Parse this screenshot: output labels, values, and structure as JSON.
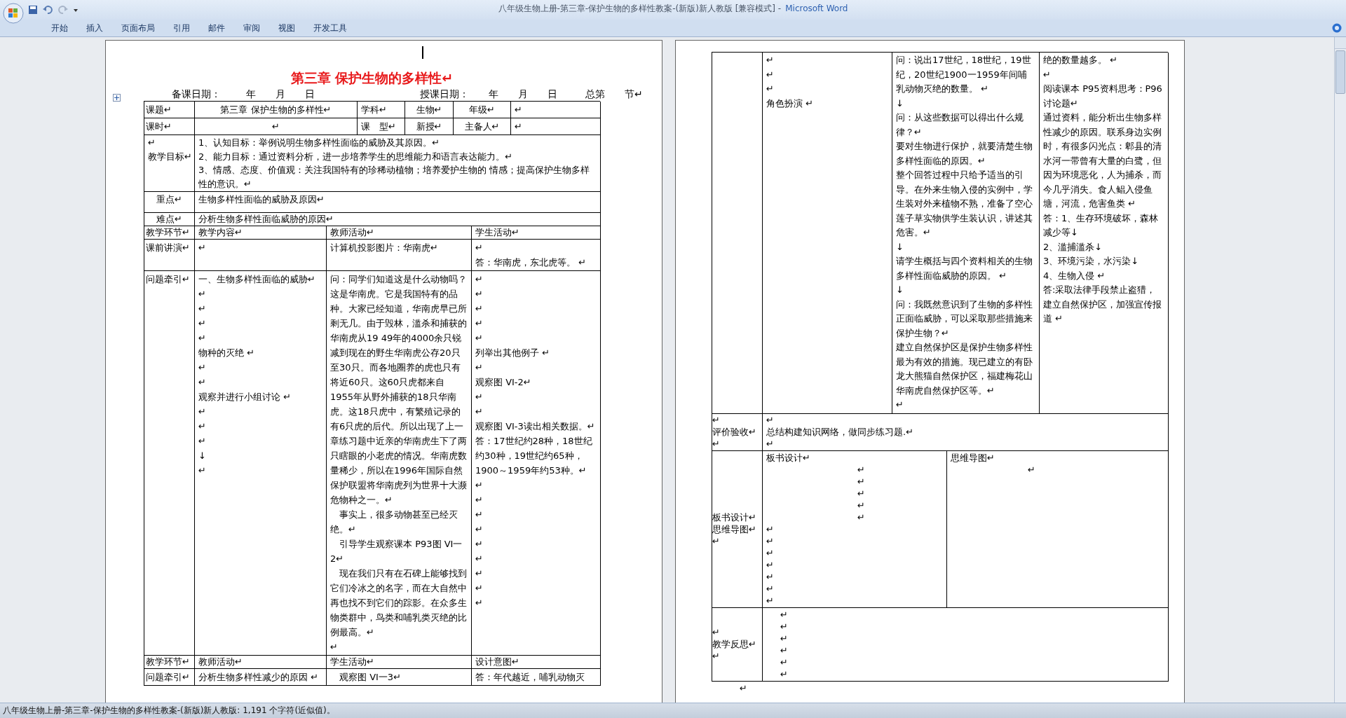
{
  "window": {
    "document_title": "八年级生物上册-第三章-保护生物的多样性教案-(新版)新人教版 [兼容模式] -",
    "app_name": "Microsoft Word"
  },
  "ribbon_tabs": [
    {
      "label": "开始",
      "selected": false
    },
    {
      "label": "插入",
      "selected": false
    },
    {
      "label": "页面布局",
      "selected": false
    },
    {
      "label": "引用",
      "selected": false
    },
    {
      "label": "邮件",
      "selected": false
    },
    {
      "label": "审阅",
      "selected": false
    },
    {
      "label": "视图",
      "selected": false
    },
    {
      "label": "开发工具",
      "selected": false
    }
  ],
  "left_page": {
    "heading": "第三章  保护生物的多样性↵",
    "prep_date": [
      "备课日期：",
      "年",
      "月",
      "日"
    ],
    "class_date": [
      "授课日期：",
      "年",
      "月",
      "日"
    ],
    "total": [
      "总第",
      "节↵"
    ],
    "info_rows": [
      [
        "课题↵",
        "第三章 保护生物的多样性↵",
        "学科↵",
        "生物↵",
        "年级↵",
        "↵"
      ],
      [
        "课时↵",
        "↵",
        "课　型↵",
        "新授↵",
        "主备人↵",
        "↵"
      ]
    ],
    "objectives": {
      "label": [
        "↵",
        "教学目标↵"
      ],
      "items": [
        "1、认知目标：举例说明生物多样性面临的威胁及其原因。↵",
        "2、能力目标：通过资料分析，进一步培养学生的思维能力和语言表达能力。↵",
        "3、情感、态度、价值观：关注我国特有的珍稀动植物；培养爱护生物的 情感；提高保护生物多样性的意识。↵"
      ]
    },
    "key_points": [
      {
        "label": "重点↵",
        "text": "生物多样性面临的威胁及原因↵"
      },
      {
        "label": "难点↵",
        "text": "分析生物多样性面临威胁的原因↵"
      }
    ],
    "lesson_rows": [
      {
        "kind": "header",
        "cells": [
          [
            "教学环节↵"
          ],
          [
            "教学内容↵"
          ],
          [
            "教师活动↵"
          ],
          [
            "学生活动↵"
          ]
        ]
      },
      {
        "kind": "body",
        "cells": [
          [
            "课前讲演↵"
          ],
          [
            "↵"
          ],
          [
            "计算机投影图片：华南虎↵"
          ],
          [
            "↵",
            "答：华南虎，东北虎等。 ↵"
          ]
        ]
      },
      {
        "kind": "body",
        "cells": [
          [
            "问题牵引↵"
          ],
          [
            "一、生物多样性面临的威胁↵",
            "↵",
            "↵",
            "↵",
            "↵",
            "物种的灭绝 ↵",
            "↵",
            "↵",
            "观察并进行小组讨论 ↵",
            "↵",
            "↵",
            "↵",
            "↓",
            "↵"
          ],
          [
            "问：同学们知道这是什么动物吗？这是华南虎。它是我国特有的品种。大家已经知道，华南虎早已所剩无几。由于毁林，滥杀和捕获的华南虎从19 49年的4000余只锐减到现在的野生华南虎公存20只至30只。而各地圈养的虎也只有将近60只。这60只虎都来自1955年从野外捕获的18只华南虎。这18只虎中，有繁殖记录的有6只虎的后代。所以出现了上一章练习题中近亲的华南虎生下了两只瞎眼的小老虎的情况。华南虎数量稀少，所以在1996年国际自然保护联盟将华南虎列为世界十大濒危物种之一。↵",
            "　事实上，很多动物甚至已经灭绝。↵",
            "　引导学生观察课本 P93图 VI一2↵",
            "　现在我们只有在石碑上能够找到它们冷冰之的名字，而在大自然中再也找不到它们的踪影。在众多生物类群中，鸟类和哺乳类灭绝的比例最高。↵",
            "↵"
          ],
          [
            "↵",
            "↵",
            "↵",
            "↵",
            "↵",
            "列举出其他例子 ↵",
            "↵",
            "观察图 VI-2↵",
            "↵",
            "↵",
            "观察图 VI-3读出相关数据。↵",
            "答：17世纪约28种，18世纪约30种，19世纪约65种，1900～1959年约53种。↵",
            "↵",
            "↵",
            "↵",
            "↵",
            "↵",
            "↵",
            "↵",
            "↵",
            "↵"
          ]
        ]
      },
      {
        "kind": "header",
        "cells": [
          [
            "教学环节↵"
          ],
          [
            "教师活动↵"
          ],
          [
            "学生活动↵"
          ],
          [
            "设计意图↵"
          ]
        ]
      },
      {
        "kind": "body",
        "cells": [
          [
            "问题牵引↵"
          ],
          [
            "分析生物多样性减少的原因 ↵"
          ],
          [
            "　观察图 VI一3↵"
          ],
          [
            "答：年代越近，哺乳动物灭"
          ]
        ]
      }
    ]
  },
  "right_page": {
    "continued_row": [
      [
        "↵",
        "↵",
        "↵",
        "角色扮演 ↵"
      ],
      [
        "问：说出17世纪，18世纪，19世纪，20世纪1900一1959年间哺乳动物灭绝的数量。 ↵",
        "↓",
        "问：从这些数据可以得出什么规律？↵",
        "要对生物进行保护，就要清楚生物多样性面临的原因。↵",
        "整个回答过程中只给予适当的引导。在外来生物入侵的实例中，学生装对外来植物不熟，准备了空心莲子草实物供学生装认识，讲述其危害。↵",
        "↓",
        "请学生概括与四个资料相关的生物多样性面临威胁的原因。 ↵",
        "↓",
        "问：我既然意识到了生物的多样性正面临威胁，可以采取那些措施来保护生物？↵",
        "建立自然保护区是保护生物多样性最为有效的措施。现已建立的有卧龙大熊猫自然保护区，福建梅花山华南虎自然保护区等。↵",
        "↵"
      ],
      [
        "绝的数量越多。 ↵",
        "↵",
        "阅读课本 P95资料思考：P96讨论题↵",
        "通过资料，能分析出生物多样性减少的原因。联系身边实例时，有很多闪光点：郫县的清水河一带曾有大量的白鹭，但因为环境恶化，人为捕杀，而今几乎消失。食人鲳入侵鱼塘，河流，危害鱼类 ↵",
        "答：1、生存环境破坏，森林减少等↓",
        "2、滥捕滥杀↓",
        "3、环境污染，水污染↓",
        "4、生物入侵 ↵",
        "答:采取法律手段禁止盗猎，建立自然保护区，加强宣传报道 ↵"
      ]
    ],
    "evaluation": {
      "label": [
        "↵",
        "评价验收↵",
        "↵"
      ],
      "content": [
        "↵",
        "总结构建知识网络，做同步练习题.↵",
        "↵"
      ]
    },
    "board": {
      "label": [
        "板书设计↵",
        "思维导图↵",
        "↵"
      ],
      "board_design": [
        "板书设计↵",
        "↵",
        "↵",
        "↵",
        "↵",
        "↵",
        "↵",
        "↵",
        "↵",
        "↵",
        "↵",
        "↵",
        "↵"
      ],
      "mind_map": [
        "思维导图↵",
        "↵"
      ]
    },
    "reflection": {
      "label": [
        "↵",
        "教学反思↵",
        "↵"
      ],
      "content": [
        "↵",
        "↵",
        "↵",
        "↵",
        "↵",
        "↵"
      ]
    },
    "after_table": "↵"
  },
  "status_bar": "八年级生物上册-第三章-保护生物的多样性教案-(新版)新人教版: 1,191 个字符(近似值)。"
}
